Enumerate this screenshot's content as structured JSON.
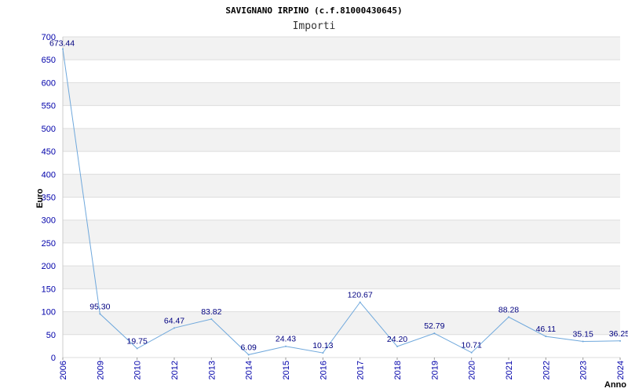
{
  "chart_data": {
    "type": "line",
    "title": "SAVIGNANO IRPINO (c.f.81000430645)",
    "subtitle": "Importi",
    "xlabel": "Anno",
    "ylabel": "Euro",
    "categories": [
      "2006",
      "2009",
      "2010",
      "2012",
      "2013",
      "2014",
      "2015",
      "2016",
      "2017",
      "2018",
      "2019",
      "2020",
      "2021",
      "2022",
      "2023",
      "2024"
    ],
    "values": [
      673.44,
      95.3,
      19.75,
      64.47,
      83.82,
      6.09,
      24.43,
      10.13,
      120.67,
      24.2,
      52.79,
      10.71,
      88.28,
      46.11,
      35.15,
      36.25
    ],
    "value_labels": [
      "673.44",
      "95.30",
      "19.75",
      "64.47",
      "83.82",
      "6.09",
      "24.43",
      "10.13",
      "120.67",
      "24.20",
      "52.79",
      "10.71",
      "88.28",
      "46.11",
      "35.15",
      "36.25"
    ],
    "ylim": [
      0,
      700
    ],
    "yticks": [
      0,
      50,
      100,
      150,
      200,
      250,
      300,
      350,
      400,
      450,
      500,
      550,
      600,
      650,
      700
    ],
    "grid": true,
    "line_color": "#6fa8dc",
    "band_color": "#f2f2f2",
    "tick_color": "#0000aa"
  }
}
